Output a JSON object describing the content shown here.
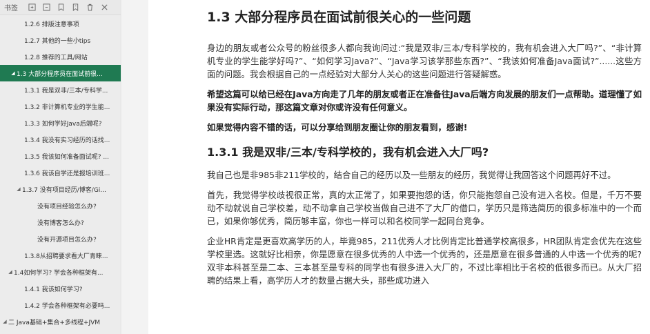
{
  "sidebar": {
    "title": "书签",
    "toolbar_icons": [
      "expand-all-icon",
      "collapse-all-icon",
      "add-bookmark-icon",
      "bookmark-edit-icon",
      "delete-icon",
      "close-icon"
    ],
    "items": [
      {
        "label": "1.2.6 排版注意事项",
        "level": 2,
        "active": false,
        "tri": ""
      },
      {
        "label": "1.2.7 其他的一些小tips",
        "level": 2,
        "active": false,
        "tri": ""
      },
      {
        "label": "1.2.8 推荐的工具/网站",
        "level": 2,
        "active": false,
        "tri": ""
      },
      {
        "label": "1.3 大部分程序员在面试前很...",
        "level": 1,
        "active": true,
        "tri": "◢"
      },
      {
        "label": "1.3.1 我是双非/三本/专科学...",
        "level": 2,
        "active": false,
        "tri": ""
      },
      {
        "label": "1.3.2 非计算机专业的学生能...",
        "level": 2,
        "active": false,
        "tri": ""
      },
      {
        "label": "1.3.3 如何学好Java后端呢?",
        "level": 2,
        "active": false,
        "tri": ""
      },
      {
        "label": "1.3.4 我没有实习经历的话找...",
        "level": 2,
        "active": false,
        "tri": ""
      },
      {
        "label": "1.3.5 我该如何准备面试呢? ...",
        "level": 2,
        "active": false,
        "tri": ""
      },
      {
        "label": "1.3.6 我该自学还是报培训班...",
        "level": 2,
        "active": false,
        "tri": ""
      },
      {
        "label": "1.3.7 没有项目经历/博客/Gi...",
        "level": 2,
        "active": false,
        "tri": "◢"
      },
      {
        "label": "没有项目经验怎么办?",
        "level": 4,
        "active": false,
        "tri": ""
      },
      {
        "label": "没有博客怎么办?",
        "level": 4,
        "active": false,
        "tri": ""
      },
      {
        "label": "没有开源项目怎么办?",
        "level": 4,
        "active": false,
        "tri": ""
      },
      {
        "label": "1.3.8从招聘要求看大厂青睐...",
        "level": 2,
        "active": false,
        "tri": ""
      },
      {
        "label": "1.4如何学习? 学会各种框架有...",
        "level": 1,
        "active": false,
        "tri": "◢"
      },
      {
        "label": "1.4.1 我该如何学习?",
        "level": 2,
        "active": false,
        "tri": ""
      },
      {
        "label": "1.4.2 学会各种框架有必要吗...",
        "level": 2,
        "active": false,
        "tri": ""
      },
      {
        "label": "二 Java基础+集合+多线程+JVM",
        "level": 0,
        "active": false,
        "tri": "◢"
      }
    ]
  },
  "document": {
    "heading": "1.3 大部分程序员在面试前很关心的一些问题",
    "intro": "身边的朋友或者公众号的粉丝很多人都向我询问过:“我是双非/三本/专科学校的，我有机会进入大厂吗?”、“非计算机专业的学生能学好吗?”、“如何学习Java?”、“Java学习该学那些东西?”、“我该如何准备Java面试?”......这些方面的问题。我会根据自己的一点经验对大部分人关心的这些问题进行答疑解惑。",
    "bold1": "希望这篇可以给已经在Java方向走了几年的朋友或者正在准备往Java后端方向发展的朋友们一点帮助。道理懂了如果没有实际行动，那这篇文章对你或许没有任何意义。",
    "bold2": "如果觉得内容不错的话，可以分享给到朋友圈让你的朋友看到，感谢!",
    "subheading": "1.3.1 我是双非/三本/专科学校的，我有机会进入大厂吗?",
    "p1": "我自己也是非985非211学校的，结合自己的经历以及一些朋友的经历，我觉得让我回答这个问题再好不过。",
    "p2": "首先，我觉得学校歧视很正常，真的太正常了，如果要抱怨的话，你只能抱怨自己没有进入名校。但是，千万不要动不动就说自己学校差，动不动拿自己学校当做自己进不了大厂的借口，学历只是筛选简历的很多标准中的一个而已，如果你够优秀，简历够丰富，你也一样可以和名校同学一起同台竞争。",
    "p3": "企业HR肯定是更喜欢高学历的人，毕竟985，211优秀人才比例肯定比普通学校高很多，HR团队肯定会优先在这些学校里选。这就好比相亲，你是愿意在很多优秀的人中选一个优秀的，还是愿意在很多普通的人中选一个优秀的呢?         双非本科甚至是二本、三本甚至是专科的同学也有很多进入大厂的，不过比率相比于名校的低很多而已。从大厂招聘的结果上看，高学历人才的数量占据大头，那些成功进入"
  }
}
